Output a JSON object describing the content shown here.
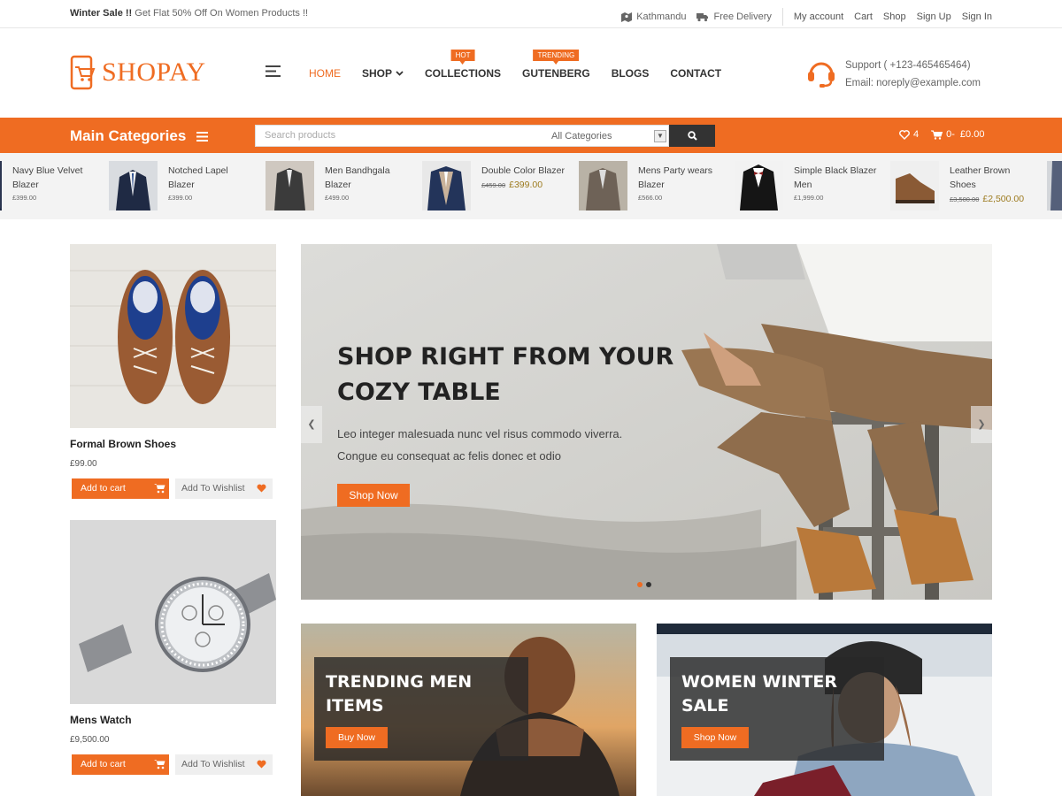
{
  "topbar": {
    "promo_bold": "Winter Sale !!",
    "promo_text": " Get Flat 50% Off On Women Products !!",
    "location": "Kathmandu",
    "delivery": "Free Delivery",
    "links": [
      "My account",
      "Cart",
      "Shop",
      "Sign Up",
      "Sign In"
    ]
  },
  "header": {
    "logo_text": "SHOPAY",
    "nav": [
      {
        "label": "HOME",
        "badge": ""
      },
      {
        "label": "SHOP",
        "badge": ""
      },
      {
        "label": "COLLECTIONS",
        "badge": "HOT"
      },
      {
        "label": "GUTENBERG",
        "badge": "TRENDING"
      },
      {
        "label": "BLOGS",
        "badge": ""
      },
      {
        "label": "CONTACT",
        "badge": ""
      }
    ],
    "support_line": "Support ( +123-465465464)",
    "email_line": "Email: noreply@example.com"
  },
  "catbar": {
    "main_categories": "Main Categories",
    "search_placeholder": "Search products",
    "category_select": "All Categories",
    "wishlist_count": "4",
    "cart_count": "0-",
    "cart_total": "£0.00"
  },
  "strip": [
    {
      "name": "Navy Blue Velvet Blazer",
      "old": "",
      "price": "£399.00"
    },
    {
      "name": "Notched Lapel Blazer",
      "old": "",
      "price": "£399.00"
    },
    {
      "name": "Men Bandhgala Blazer",
      "old": "",
      "price": "£499.00"
    },
    {
      "name": "Double Color Blazer",
      "old": "£459.00",
      "price": "£399.00"
    },
    {
      "name": "Mens Party wears Blazer",
      "old": "",
      "price": "£566.00"
    },
    {
      "name": "Simple Black Blazer Men",
      "old": "",
      "price": "£1,999.00"
    },
    {
      "name": "Leather Brown Shoes",
      "old": "£3,500.00",
      "price": "£2,500.00"
    }
  ],
  "side_products": [
    {
      "title": "Formal Brown Shoes",
      "price": "£99.00",
      "cart": "Add to cart",
      "wish": "Add To Wishlist"
    },
    {
      "title": "Mens Watch",
      "price": "£9,500.00",
      "cart": "Add to cart",
      "wish": "Add To Wishlist"
    }
  ],
  "hero": {
    "title": "SHOP RIGHT FROM YOUR COZY TABLE",
    "subtitle_1": "Leo integer malesuada nunc vel risus commodo viverra.",
    "subtitle_2": "Congue eu consequat ac felis donec et odio",
    "button": "Shop Now"
  },
  "banners": [
    {
      "title": "TRENDING MEN ITEMS",
      "button": "Buy Now"
    },
    {
      "title": "WOMEN WINTER SALE",
      "button": "Shop Now"
    }
  ],
  "colors": {
    "accent": "#ef6c22",
    "dark": "#333333"
  },
  "icons": [
    "map-icon",
    "truck-icon",
    "logo-cart-icon",
    "menu-icon",
    "chevron-down-icon",
    "headset-icon",
    "search-icon",
    "heart-icon",
    "cart-icon",
    "chevron-left-icon",
    "chevron-right-icon"
  ]
}
